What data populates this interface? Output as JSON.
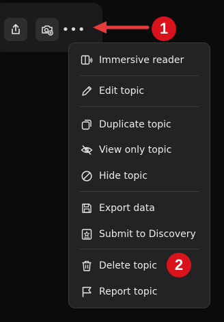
{
  "toolbar": {
    "share_icon": "share-icon",
    "camera_icon": "camera-add-icon",
    "more_label": "•••"
  },
  "annotations": {
    "step1": "1",
    "step2": "2",
    "badge_color": "#d9131b"
  },
  "menu": {
    "items": [
      {
        "label": "Immersive reader",
        "icon": "immersive-reader-icon"
      },
      {
        "label": "Edit topic",
        "icon": "pencil-icon"
      },
      {
        "label": "Duplicate topic",
        "icon": "duplicate-icon"
      },
      {
        "label": "View only topic",
        "icon": "eye-off-icon"
      },
      {
        "label": "Hide topic",
        "icon": "hide-icon"
      },
      {
        "label": "Export data",
        "icon": "save-icon"
      },
      {
        "label": "Submit to Discovery",
        "icon": "discovery-icon"
      },
      {
        "label": "Delete topic",
        "icon": "trash-icon"
      },
      {
        "label": "Report topic",
        "icon": "flag-icon"
      }
    ]
  }
}
